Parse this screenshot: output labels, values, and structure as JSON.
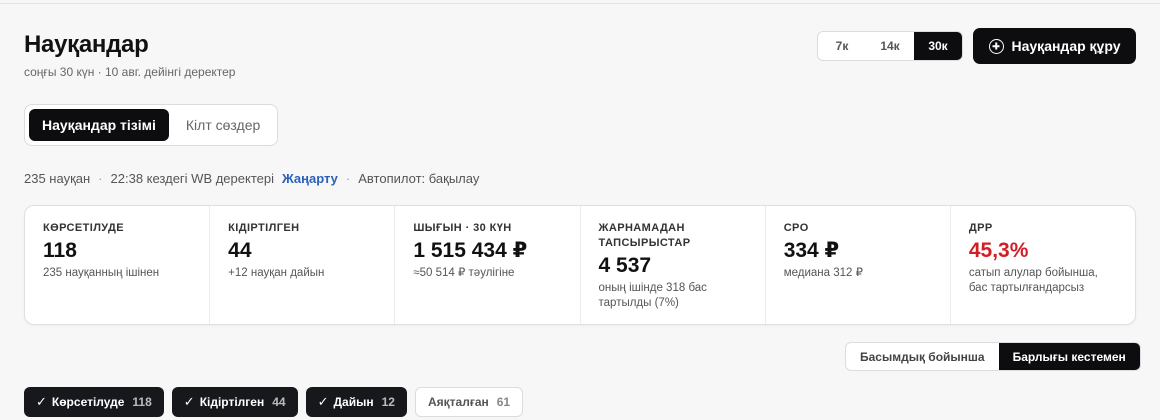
{
  "header": {
    "title": "Науқандар",
    "subtitle": "соңғы 30 күн · 10 авг. дейінгі деректер",
    "period_options": [
      "7к",
      "14к",
      "30к"
    ],
    "period_selected": "30к",
    "create_button_label": "Науқандар құру"
  },
  "tabs": [
    {
      "label": "Науқандар тізімі",
      "active": true
    },
    {
      "label": "Кілт сөздер",
      "active": false
    }
  ],
  "status": {
    "count": "235 науқан",
    "data_time": "22:38 кездегі WB деректері",
    "refresh_label": "Жаңарту",
    "autopilot": "Автопилот: бақылау"
  },
  "metrics": [
    {
      "label": "КӨРСЕТІЛУДЕ",
      "value": "118",
      "sub": "235 науқанның ішінен"
    },
    {
      "label": "КІДІРТІЛГЕН",
      "value": "44",
      "sub": "+12 науқан дайын"
    },
    {
      "label": "ШЫҒЫН · 30 КҮН",
      "value": "1 515 434 ₽",
      "sub": "≈50 514 ₽ тәулігіне"
    },
    {
      "label": "ЖАРНАМАДАН ТАПСЫРЫСТАР",
      "value": "4 537",
      "sub": "оның ішінде 318 бас тартылды (7%)"
    },
    {
      "label": "CPO",
      "value": "334 ₽",
      "sub": "медиана 312 ₽"
    },
    {
      "label": "ДРР",
      "value": "45,3%",
      "sub": "сатып алулар бойынша, бас тартылғандарсыз"
    }
  ],
  "view_options": [
    {
      "label": "Басымдық бойынша",
      "active": false
    },
    {
      "label": "Барлығы кестемен",
      "active": true
    }
  ],
  "filters": [
    {
      "label": "Көрсетілуде",
      "count": "118",
      "active": true
    },
    {
      "label": "Кідіртілген",
      "count": "44",
      "active": true
    },
    {
      "label": "Дайын",
      "count": "12",
      "active": true
    },
    {
      "label": "Аяқталған",
      "count": "61",
      "active": false
    }
  ],
  "colors": {
    "accent_dark": "#0d0d10",
    "link_blue": "#2b5fb8",
    "alert_red": "#d01f26"
  },
  "icons": {
    "create": "plus-circle-icon",
    "filter_check": "check-icon"
  },
  "glyphs": {
    "check": "✓",
    "separator": "·"
  }
}
